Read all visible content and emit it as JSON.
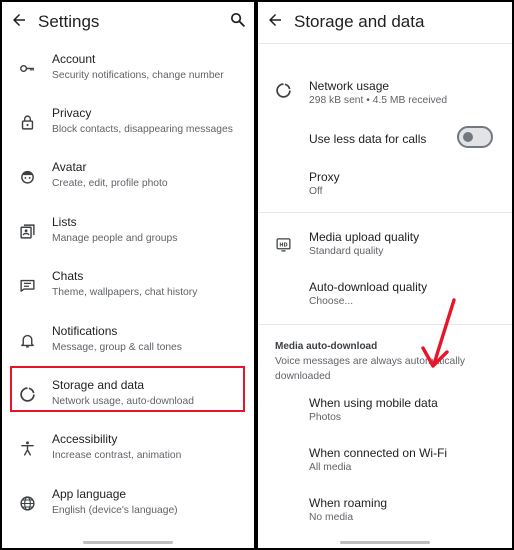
{
  "left": {
    "title": "Settings",
    "items": [
      {
        "title": "Account",
        "subtitle": "Security notifications, change number",
        "icon": "key-icon"
      },
      {
        "title": "Privacy",
        "subtitle": "Block contacts, disappearing messages",
        "icon": "lock-icon"
      },
      {
        "title": "Avatar",
        "subtitle": "Create, edit, profile photo",
        "icon": "avatar-face-icon"
      },
      {
        "title": "Lists",
        "subtitle": "Manage people and groups",
        "icon": "lists-icon"
      },
      {
        "title": "Chats",
        "subtitle": "Theme, wallpapers, chat history",
        "icon": "chat-icon"
      },
      {
        "title": "Notifications",
        "subtitle": "Message, group & call tones",
        "icon": "bell-icon"
      },
      {
        "title": "Storage and data",
        "subtitle": "Network usage, auto-download",
        "icon": "storage-icon"
      },
      {
        "title": "Accessibility",
        "subtitle": "Increase contrast, animation",
        "icon": "accessibility-icon"
      },
      {
        "title": "App language",
        "subtitle": "English (device's language)",
        "icon": "globe-icon"
      }
    ],
    "highlight_color": "#e8152a"
  },
  "right": {
    "title": "Storage and data",
    "network_usage": {
      "title": "Network usage",
      "subtitle": "298 kB sent • 4.5 MB received"
    },
    "less_data": {
      "title": "Use less data for calls",
      "enabled": false
    },
    "proxy": {
      "title": "Proxy",
      "subtitle": "Off"
    },
    "media_upload": {
      "title": "Media upload quality",
      "subtitle": "Standard quality"
    },
    "auto_download_quality": {
      "title": "Auto-download quality",
      "subtitle": "Choose..."
    },
    "section": {
      "header": "Media auto-download",
      "description": "Voice messages are always automatically downloaded"
    },
    "mobile_data": {
      "title": "When using mobile data",
      "subtitle": "Photos"
    },
    "wifi": {
      "title": "When connected on Wi-Fi",
      "subtitle": "All media"
    },
    "roaming": {
      "title": "When roaming",
      "subtitle": "No media"
    },
    "arrow_color": "#e8152a"
  }
}
